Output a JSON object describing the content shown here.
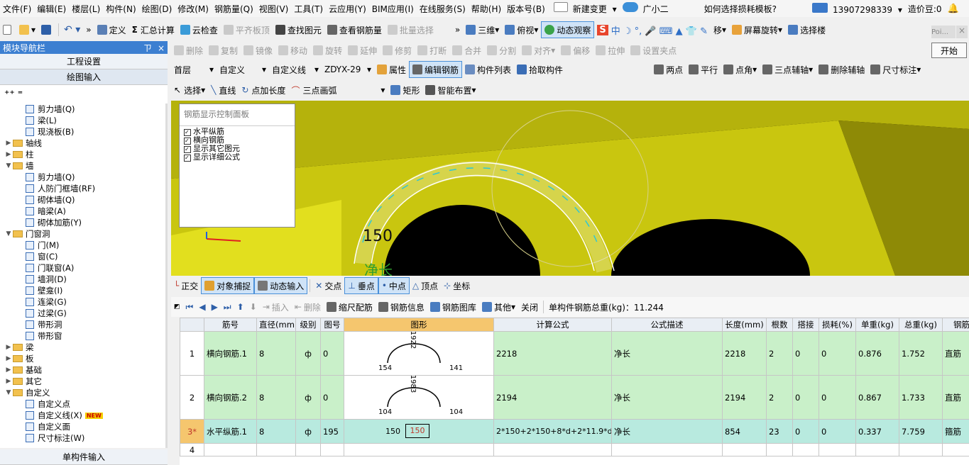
{
  "menu": [
    "文件(F)",
    "编辑(E)",
    "楼层(L)",
    "构件(N)",
    "绘图(D)",
    "修改(M)",
    "钢筋量(Q)",
    "视图(V)",
    "工具(T)",
    "云应用(Y)",
    "BIM应用(I)",
    "在线服务(S)",
    "帮助(H)",
    "版本号(B)"
  ],
  "menu_right": {
    "new_change": "新建变更",
    "assistant": "广小二",
    "hint": "如何选择损耗模板?",
    "phone": "13907298339",
    "beans": "造价豆:0"
  },
  "toolbar1": {
    "define": "定义",
    "sum": "汇总计算",
    "cloud_check": "云检查",
    "flat_top": "平齐板顶",
    "find": "查找图元",
    "view_rebar": "查看钢筋量",
    "batch": "批量选择",
    "view3d": "三维",
    "topview": "俯视",
    "dynamic": "动态观察",
    "move_label": "移",
    "screen_rotate": "屏幕旋转",
    "select_floor": "选择楼",
    "poi": "Poi...",
    "start": "开始"
  },
  "toolbar2": [
    "删除",
    "复制",
    "镜像",
    "移动",
    "旋转",
    "延伸",
    "修剪",
    "打断",
    "合并",
    "分割",
    "对齐",
    "偏移",
    "拉伸",
    "设置夹点"
  ],
  "toolbar3": {
    "floor": "首层",
    "type": "自定义",
    "kind": "自定义线",
    "code": "ZDYX-29",
    "attr": "属性",
    "edit_rebar": "编辑钢筋",
    "list": "构件列表",
    "pick": "拾取构件",
    "two_point": "两点",
    "parallel": "平行",
    "point_angle": "点角",
    "three_axis": "三点辅轴",
    "del_axis": "删除辅轴",
    "dim": "尺寸标注"
  },
  "toolbar4": {
    "select": "选择",
    "line": "直线",
    "point_len": "点加长度",
    "arc": "三点画弧",
    "rect": "矩形",
    "smart": "智能布置"
  },
  "nav": {
    "title": "模块导航栏",
    "pin": "ㄗ",
    "close": "×",
    "project": "工程设置",
    "draw": "绘图输入",
    "single": "单构件输入"
  },
  "tree": [
    {
      "t": "leaf",
      "d": 3,
      "label": "剪力墙(Q)"
    },
    {
      "t": "leaf",
      "d": 3,
      "label": "梁(L)"
    },
    {
      "t": "leaf",
      "d": 3,
      "label": "现浇板(B)"
    },
    {
      "t": "folder",
      "d": 1,
      "label": "轴线",
      "open": false
    },
    {
      "t": "folder",
      "d": 1,
      "label": "柱",
      "open": false
    },
    {
      "t": "folder",
      "d": 1,
      "label": "墙",
      "open": true
    },
    {
      "t": "leaf",
      "d": 3,
      "label": "剪力墙(Q)"
    },
    {
      "t": "leaf",
      "d": 3,
      "label": "人防门框墙(RF)"
    },
    {
      "t": "leaf",
      "d": 3,
      "label": "砌体墙(Q)"
    },
    {
      "t": "leaf",
      "d": 3,
      "label": "暗梁(A)"
    },
    {
      "t": "leaf",
      "d": 3,
      "label": "砌体加筋(Y)"
    },
    {
      "t": "folder",
      "d": 1,
      "label": "门窗洞",
      "open": true
    },
    {
      "t": "leaf",
      "d": 3,
      "label": "门(M)"
    },
    {
      "t": "leaf",
      "d": 3,
      "label": "窗(C)"
    },
    {
      "t": "leaf",
      "d": 3,
      "label": "门联窗(A)"
    },
    {
      "t": "leaf",
      "d": 3,
      "label": "墙洞(D)"
    },
    {
      "t": "leaf",
      "d": 3,
      "label": "壁龛(I)"
    },
    {
      "t": "leaf",
      "d": 3,
      "label": "连梁(G)"
    },
    {
      "t": "leaf",
      "d": 3,
      "label": "过梁(G)"
    },
    {
      "t": "leaf",
      "d": 3,
      "label": "带形洞"
    },
    {
      "t": "leaf",
      "d": 3,
      "label": "带形窗"
    },
    {
      "t": "folder",
      "d": 1,
      "label": "梁",
      "open": false
    },
    {
      "t": "folder",
      "d": 1,
      "label": "板",
      "open": false
    },
    {
      "t": "folder",
      "d": 1,
      "label": "基础",
      "open": false
    },
    {
      "t": "folder",
      "d": 1,
      "label": "其它",
      "open": false
    },
    {
      "t": "folder",
      "d": 1,
      "label": "自定义",
      "open": true
    },
    {
      "t": "leaf",
      "d": 3,
      "label": "自定义点"
    },
    {
      "t": "leaf",
      "d": 3,
      "label": "自定义线(X)",
      "badge": "NEW"
    },
    {
      "t": "leaf",
      "d": 3,
      "label": "自定义面"
    },
    {
      "t": "leaf",
      "d": 3,
      "label": "尺寸标注(W)"
    }
  ],
  "rebar_panel": {
    "title": "钢筋显示控制面板",
    "options": [
      "水平纵筋",
      "横向钢筋",
      "显示其它图元",
      "显示详细公式"
    ]
  },
  "viewport": {
    "dim_label": "150",
    "net_label": "净长"
  },
  "snapbar": [
    "正交",
    "对象捕捉",
    "动态输入",
    "交点",
    "垂点",
    "中点",
    "顶点",
    "坐标"
  ],
  "rebar_toolbar": {
    "insert": "插入",
    "delete": "删除",
    "scale": "缩尺配筋",
    "info": "钢筋信息",
    "lib": "钢筋图库",
    "other": "其他",
    "close": "关闭",
    "total": "单构件钢筋总重(kg)：11.244"
  },
  "table": {
    "headers": [
      "筋号",
      "直径(mm)",
      "级别",
      "图号",
      "图形",
      "计算公式",
      "公式描述",
      "长度(mm)",
      "根数",
      "搭接",
      "损耗(%)",
      "单重(kg)",
      "总重(kg)",
      "钢筋"
    ],
    "rows": [
      {
        "no": "1",
        "name": "横向钢筋.1",
        "dia": "8",
        "grade": "ф",
        "fig": "0",
        "shape": {
          "top": "1922",
          "left": "154",
          "right": "141"
        },
        "formula": "2218",
        "desc": "净长",
        "len": "2218",
        "count": "2",
        "lap": "0",
        "loss": "0",
        "unit": "0.876",
        "total": "1.752",
        "kind": "直筋"
      },
      {
        "no": "2",
        "name": "横向钢筋.2",
        "dia": "8",
        "grade": "ф",
        "fig": "0",
        "shape": {
          "top": "1983",
          "left": "104",
          "right": "104"
        },
        "formula": "2194",
        "desc": "净长",
        "len": "2194",
        "count": "2",
        "lap": "0",
        "loss": "0",
        "unit": "0.867",
        "total": "1.733",
        "kind": "直筋"
      },
      {
        "no": "3*",
        "name": "水平纵筋.1",
        "dia": "8",
        "grade": "ф",
        "fig": "195",
        "shape": {
          "left": "150",
          "box": "150"
        },
        "formula": "2*150+2*150+8*d+2*11.9*d",
        "desc": "净长",
        "len": "854",
        "count": "23",
        "lap": "0",
        "loss": "0",
        "unit": "0.337",
        "total": "7.759",
        "kind": "箍筋"
      },
      {
        "no": "4"
      }
    ]
  }
}
